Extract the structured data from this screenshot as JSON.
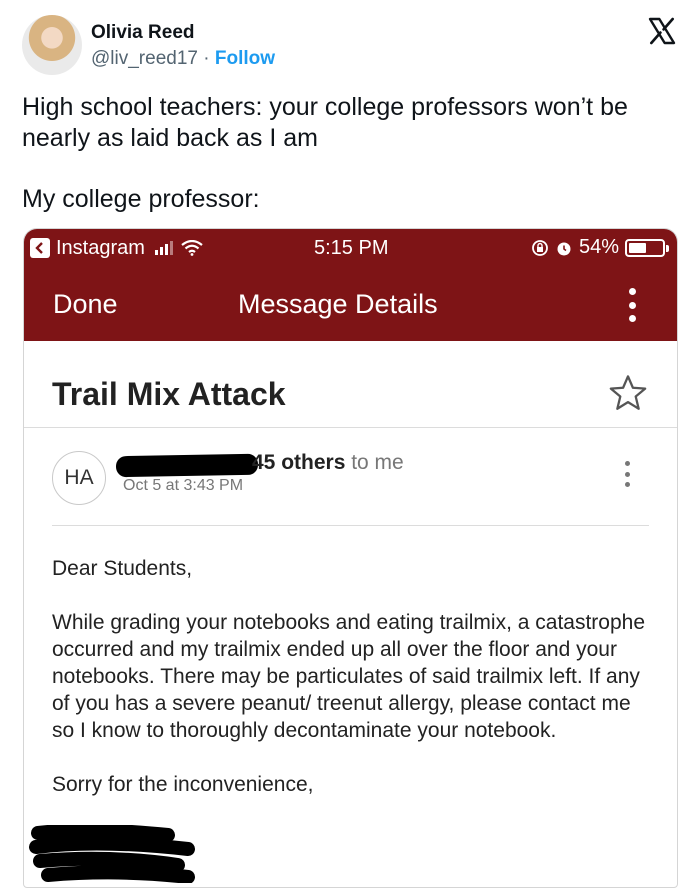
{
  "tweet": {
    "author_name": "Olivia Reed",
    "handle": "@liv_reed17",
    "separator": " · ",
    "follow_label": "Follow",
    "text_line1": "High school teachers: your college professors won’t be nearly as laid back as I am",
    "text_line2": "My college professor:"
  },
  "screenshot": {
    "status_bar": {
      "back_app": "Instagram",
      "time": "5:15 PM",
      "battery": "54%",
      "battery_level": 0.54
    },
    "nav": {
      "done_label": "Done",
      "title": "Message Details"
    },
    "email": {
      "subject": "Trail Mix Attack",
      "sender_initials": "HA",
      "recipients_others": "45 others",
      "recipients_suffix": " to me",
      "date": "Oct 5 at 3:43 PM",
      "greeting": "Dear Students,",
      "body": "While grading your notebooks and eating trailmix, a catastrophe occurred and my trailmix ended up all over the floor and your notebooks. There may be particulates of said trailmix left. If any of you has a severe peanut/ treenut allergy, please contact me so I know  to thoroughly decontaminate your notebook.",
      "closing": "Sorry for the inconvenience,"
    }
  },
  "colors": {
    "header_bg": "#7e1416",
    "follow": "#1d9bf0",
    "handle": "#536471"
  },
  "icons": [
    "x-logo-icon",
    "back-arrow-icon",
    "signal-icon",
    "wifi-icon",
    "lock-rotation-icon",
    "alarm-icon",
    "battery-icon",
    "more-vertical-icon",
    "star-icon"
  ]
}
